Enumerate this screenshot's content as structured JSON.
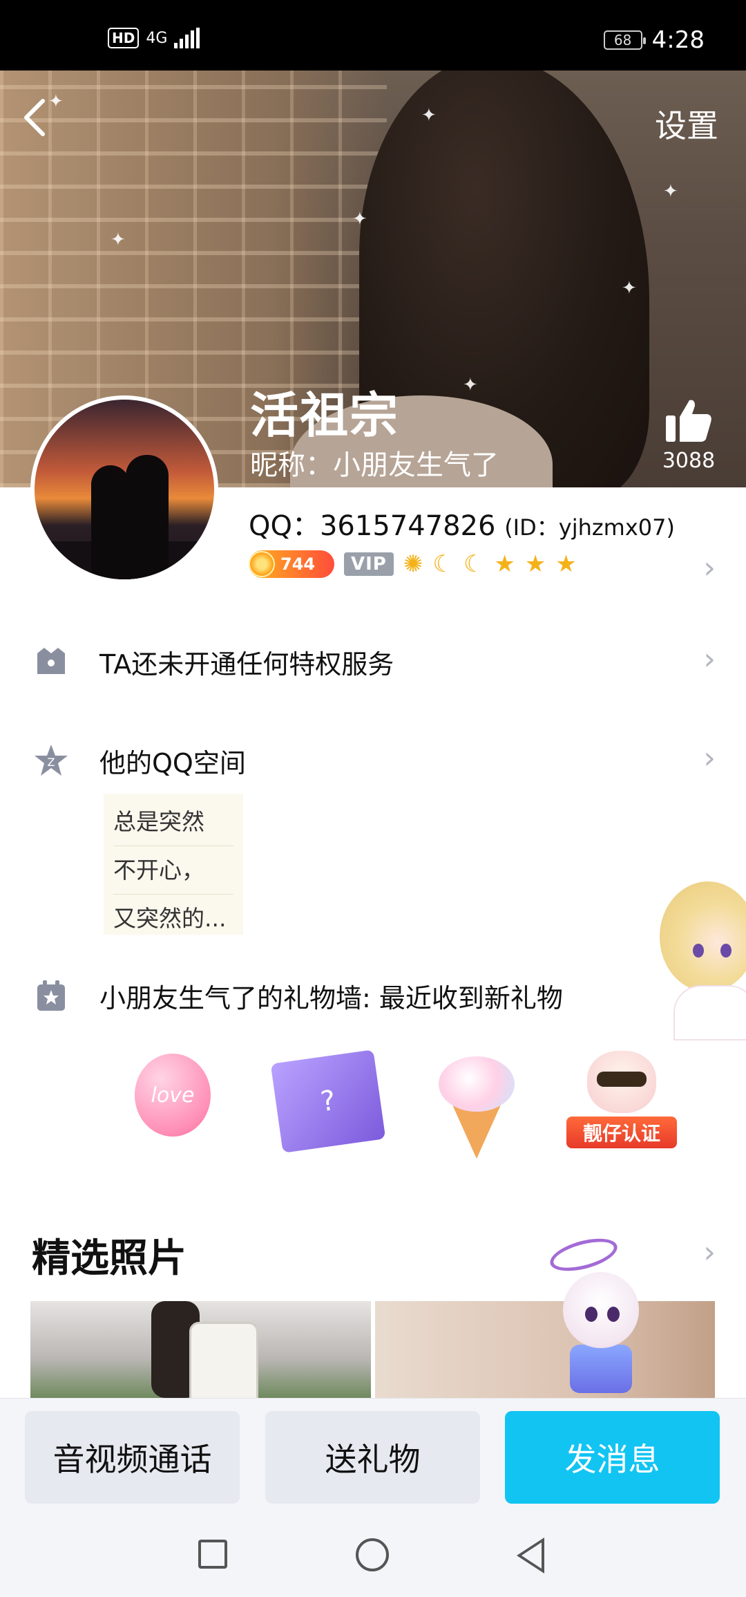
{
  "status_bar": {
    "network_hd": "HD",
    "network_gen": "4G",
    "battery": "68",
    "time": "4:28"
  },
  "header": {
    "back_icon": "chevron-left-icon",
    "settings_label": "设置"
  },
  "profile": {
    "name": "活祖宗",
    "nickname": "昵称：小朋友生气了",
    "likes": "3088",
    "qq_label": "QQ：3615747826",
    "id_label": "(ID：yjhzmx07)",
    "level": "744",
    "vip": "VIP"
  },
  "rows": {
    "privilege": "TA还未开通任何特权服务",
    "qzone": "他的QQ空间",
    "gift_wall": "小朋友生气了的礼物墙: 最近收到新礼物"
  },
  "qzone_quote": [
    "总是突然",
    "不开心，",
    "又突然的..."
  ],
  "gifts": [
    {
      "name": "balloon-gift",
      "label": "love"
    },
    {
      "name": "magic-book-gift",
      "label": "?"
    },
    {
      "name": "ice-cream-gift",
      "label": ""
    },
    {
      "name": "cool-badge-gift",
      "label": "靓仔认证"
    }
  ],
  "featured": {
    "title": "精选照片"
  },
  "actions": {
    "call": "音视频通话",
    "gift": "送礼物",
    "message": "发消息"
  },
  "colors": {
    "accent": "#12c4f2",
    "icon_gray": "#8a8fa0"
  }
}
